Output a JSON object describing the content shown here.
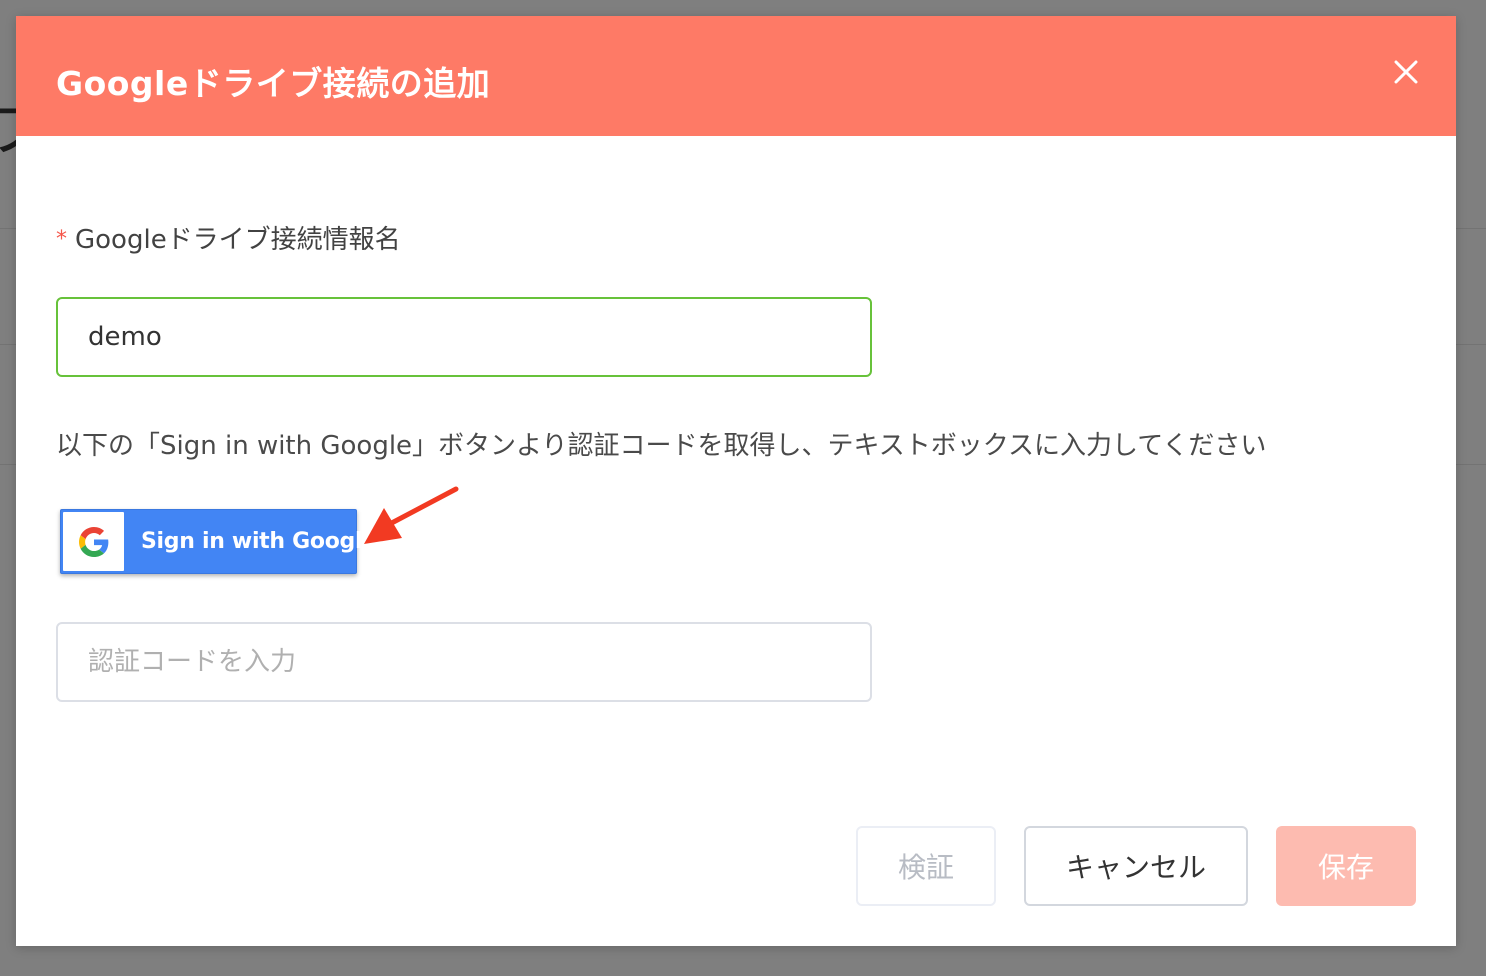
{
  "dialog": {
    "title": "Googleドライブ接続の追加",
    "close_icon": "close-icon",
    "header_color": "#fe7a66"
  },
  "form": {
    "name_field": {
      "required_mark": "*",
      "label": "Googleドライブ接続情報名",
      "value": "demo"
    },
    "instruction": "以下の「Sign in with Google」ボタンより認証コードを取得し、テキストボックスに入力してください",
    "google_button": {
      "label": "Sign in with Google",
      "icon": "google-g-logo-icon",
      "color": "#4285f4"
    },
    "auth_code_field": {
      "value": "",
      "placeholder": "認証コードを入力"
    }
  },
  "footer": {
    "verify_label": "検証",
    "cancel_label": "キャンセル",
    "save_label": "保存"
  },
  "background": {
    "partial_glyph": "ブ"
  },
  "colors": {
    "accent": "#fe7a66",
    "valid_border": "#67c23a",
    "annotation_arrow": "#f23a22"
  }
}
